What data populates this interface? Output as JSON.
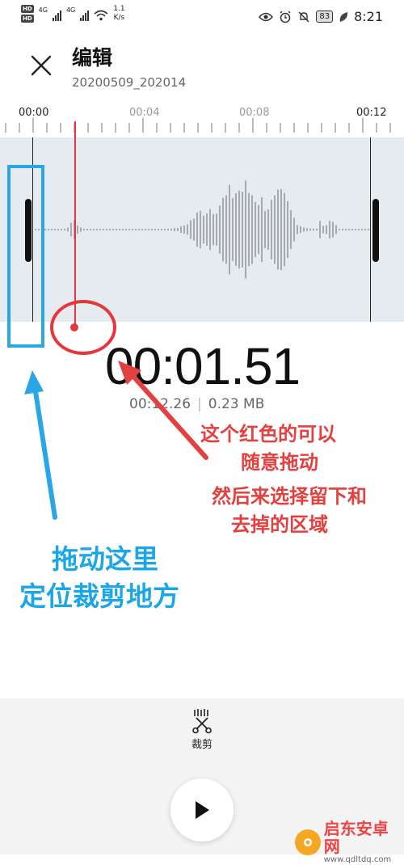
{
  "status_bar": {
    "hd1": "HD",
    "hd2": "HD",
    "net1": "4G",
    "net2": "4G",
    "speed_value": "1.1",
    "speed_unit": "K/s",
    "battery": "83",
    "time": "8:21"
  },
  "header": {
    "title": "编辑",
    "filename": "20200509_202014"
  },
  "timeline": {
    "labels": [
      "00:00",
      "00:04",
      "00:08",
      "00:12"
    ]
  },
  "player": {
    "current_time": "00:01.51",
    "duration": "00:12.26",
    "size": "0.23 MB"
  },
  "annotations": {
    "red_line1": "这个红色的可以",
    "red_line2": "随意拖动",
    "red_line3": "然后来选择留下和",
    "red_line4": "去掉的区域",
    "blue_line1": "拖动这里",
    "blue_line2": "定位裁剪地方"
  },
  "toolbar": {
    "crop_label": "裁剪"
  },
  "watermark": {
    "name": "启东安卓网",
    "url": "www.qdltdq.com"
  },
  "colors": {
    "accent_red": "#e5363b",
    "accent_blue": "#2aa5e6",
    "wave_bg": "#e6ebef"
  }
}
